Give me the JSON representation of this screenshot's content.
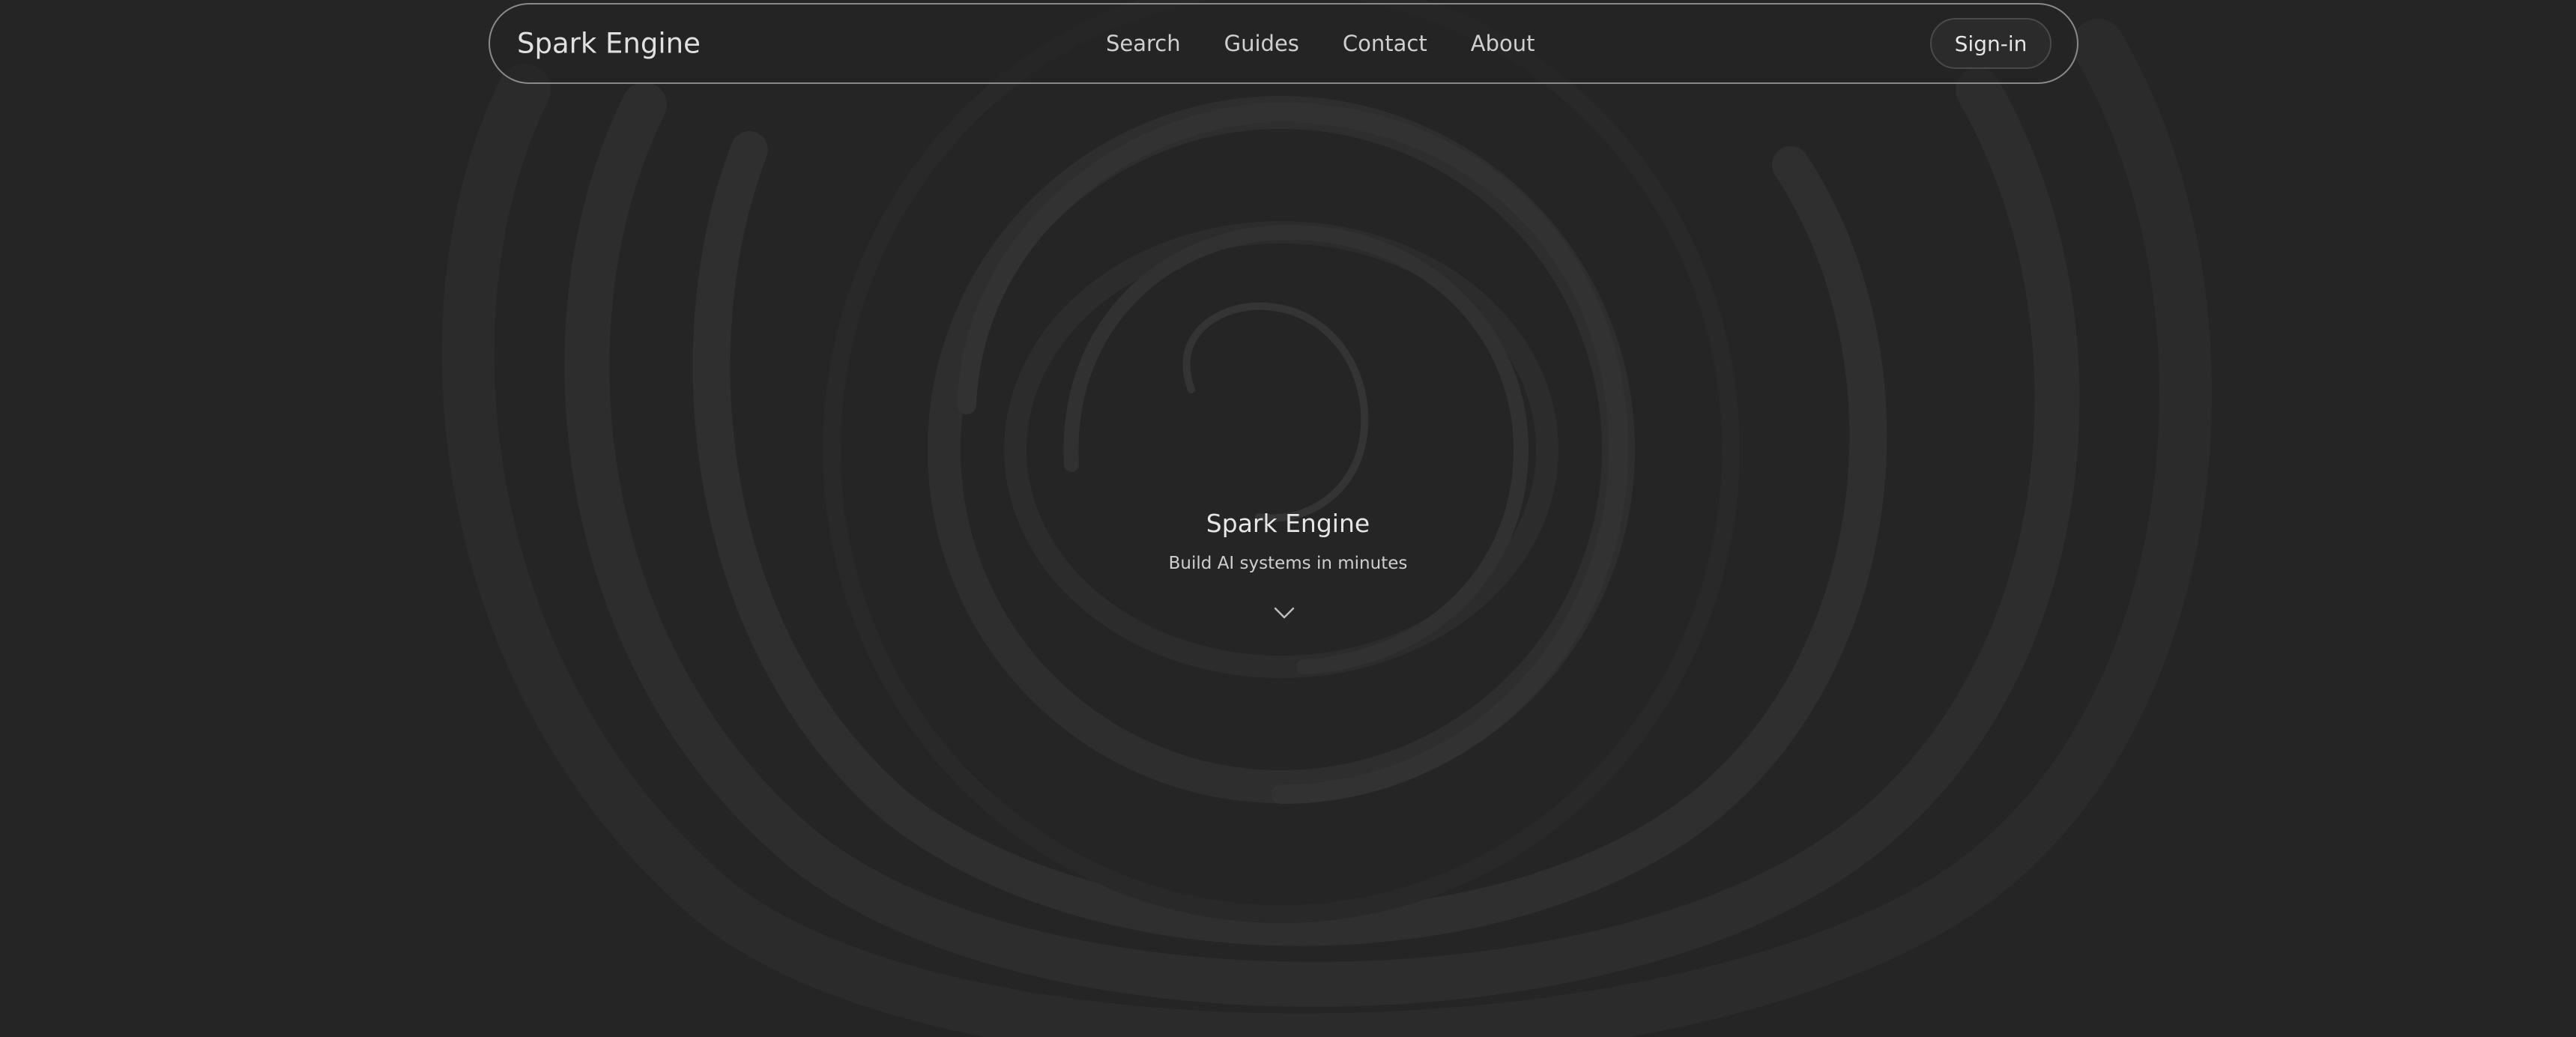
{
  "header": {
    "brand": "Spark Engine",
    "nav": [
      {
        "label": "Search"
      },
      {
        "label": "Guides"
      },
      {
        "label": "Contact"
      },
      {
        "label": "About"
      }
    ],
    "signin_label": "Sign-in"
  },
  "hero": {
    "title": "Spark Engine",
    "subtitle": "Build AI systems in minutes",
    "scroll_icon": "chevron-down-icon"
  },
  "colors": {
    "background": "#252525",
    "nav_border": "#8a8a8a",
    "text": "#e6e6e6",
    "muted_text": "#cfcfcf"
  }
}
